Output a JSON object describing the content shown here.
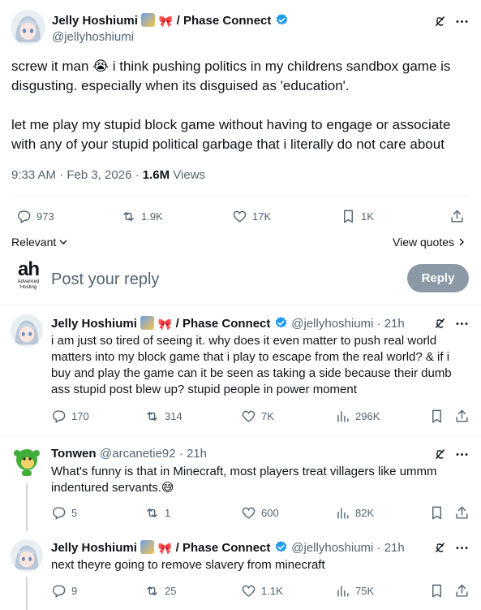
{
  "main_post": {
    "author_name": "Jelly Hoshiumi",
    "affiliation": "/ Phase Connect",
    "handle": "@jellyhoshiumi",
    "paragraph1_line1": "screw it man 😭 i think pushing politics in my childrens sandbox game is",
    "paragraph1_line2": "disgusting. especially when its disguised as 'education'.",
    "paragraph2_line1": "let me play my stupid block game without having to engage or associate",
    "paragraph2_line2": "with any of your stupid political garbage that i literally do not care about",
    "timestamp": "9:33 AM · Feb 3, 2026 ·",
    "views_count": "1.6M",
    "views_label": "Views",
    "metrics": {
      "replies": "973",
      "reposts": "1.9K",
      "likes": "17K",
      "bookmarks": "1K"
    }
  },
  "sort": {
    "label": "Relevant",
    "view_quotes": "View quotes"
  },
  "composer": {
    "logo_text": "ah",
    "logo_sub1": "Advanced",
    "logo_sub2": "Hosting",
    "placeholder": "Post your reply",
    "button": "Reply"
  },
  "replies": [
    {
      "author_name": "Jelly Hoshiumi",
      "affiliation": "/ Phase Connect",
      "handle": "@jellyhoshiumi · 21h",
      "line1": "i am just so tired of seeing it. why does it even matter to push real world",
      "line2": "matters into my block game that i play to escape from the real world? & if i",
      "line3": "buy and play the game can it be seen as taking a side because their dumb",
      "line4": "ass stupid post blew up? stupid people in power moment",
      "replies": "170",
      "reposts": "314",
      "likes": "7K",
      "views": "296K"
    },
    {
      "author_name": "Tonwen",
      "handle": "@arcanetie92 · 21h",
      "line1": "What's funny is that in Minecraft, most players treat villagers like ummm",
      "line2": "indentured servants.😅",
      "replies": "5",
      "reposts": "1",
      "likes": "600",
      "views": "82K"
    },
    {
      "author_name": "Jelly Hoshiumi",
      "affiliation": "/ Phase Connect",
      "handle": "@jellyhoshiumi · 21h",
      "line1": "next theyre going to remove slavery from minecraft",
      "replies": "9",
      "reposts": "25",
      "likes": "1.1K",
      "views": "75K"
    }
  ],
  "colors": {
    "accent": "#1d9bf0",
    "text": "#0f1419",
    "secondary": "#536471",
    "divider": "#eff3f4",
    "reply_button": "#8b98a5"
  }
}
